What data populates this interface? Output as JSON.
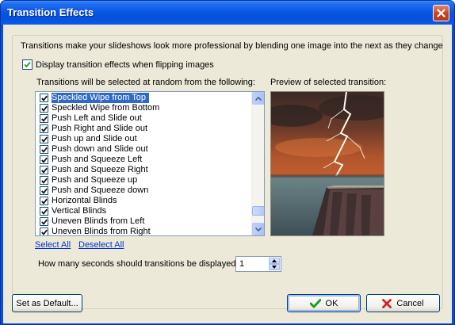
{
  "window": {
    "title": "Transition Effects"
  },
  "intro_text": "Transitions make your slideshows look more professional by blending one image into the next as they change",
  "display_checkbox": {
    "label": "Display transition effects when flipping images",
    "checked": true
  },
  "list_caption": "Transitions will be selected at random from the following:",
  "preview_caption": "Preview of selected transition:",
  "transitions": [
    {
      "label": "Speckled Wipe from Top",
      "checked": true,
      "selected": true
    },
    {
      "label": "Speckled Wipe from Bottom",
      "checked": true,
      "selected": false
    },
    {
      "label": "Push Left and Slide out",
      "checked": true,
      "selected": false
    },
    {
      "label": "Push Right and Slide out",
      "checked": true,
      "selected": false
    },
    {
      "label": "Push up and Slide out",
      "checked": true,
      "selected": false
    },
    {
      "label": "Push down and Slide out",
      "checked": true,
      "selected": false
    },
    {
      "label": "Push and Squeeze Left",
      "checked": true,
      "selected": false
    },
    {
      "label": "Push and Squeeze Right",
      "checked": true,
      "selected": false
    },
    {
      "label": "Push and Squeeze up",
      "checked": true,
      "selected": false
    },
    {
      "label": "Push and Squeeze down",
      "checked": true,
      "selected": false
    },
    {
      "label": "Horizontal Blinds",
      "checked": true,
      "selected": false
    },
    {
      "label": "Vertical Blinds",
      "checked": true,
      "selected": false
    },
    {
      "label": "Uneven Blinds from Left",
      "checked": true,
      "selected": false
    },
    {
      "label": "Uneven Blinds from Right",
      "checked": true,
      "selected": false
    }
  ],
  "links": {
    "select_all": "Select All",
    "deselect_all": "Deselect All"
  },
  "duration": {
    "label": "How many seconds should transitions be displayed:",
    "value": "1"
  },
  "buttons": {
    "set_default": "Set as Default...",
    "ok": "OK",
    "cancel": "Cancel"
  },
  "colors": {
    "titlebar": "#0a58e6",
    "dialog_bg": "#ece9d8",
    "selection": "#316ac5",
    "link": "#0033cc",
    "ok_icon": "#1a9a1a",
    "cancel_icon": "#d42020"
  },
  "icons": {
    "close": "close-icon",
    "ok": "checkmark-icon",
    "cancel": "red-x-icon"
  }
}
